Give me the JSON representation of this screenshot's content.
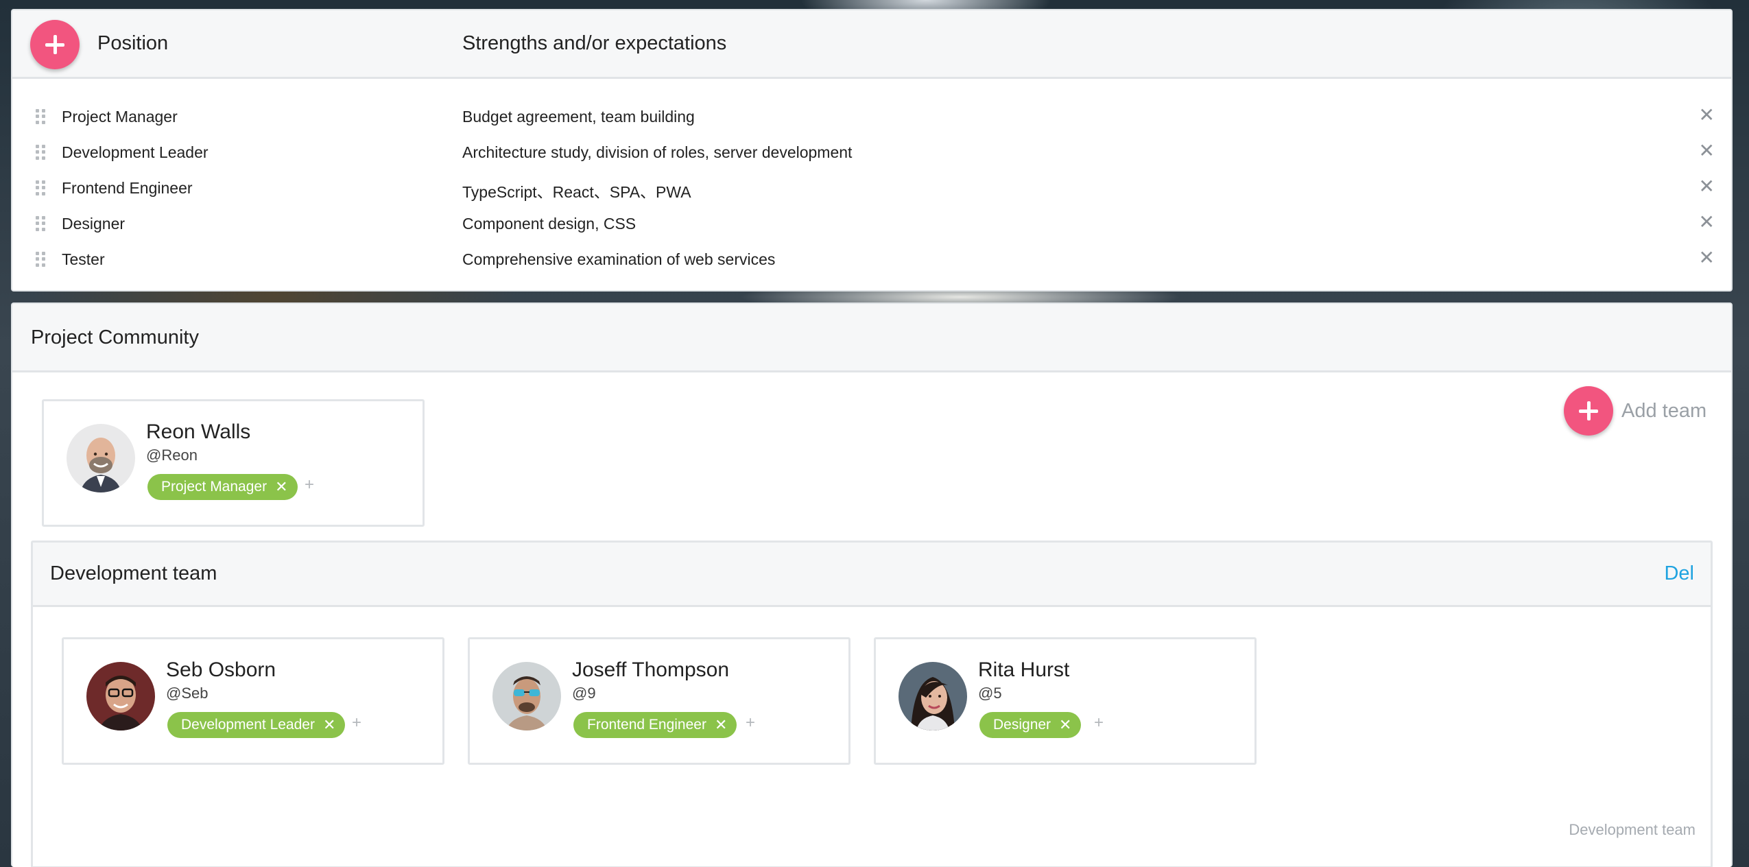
{
  "positions": {
    "header_position": "Position",
    "header_strengths": "Strengths and/or expectations",
    "rows": [
      {
        "name": "Project Manager",
        "strengths": "Budget agreement, team building"
      },
      {
        "name": "Development Leader",
        "strengths": "Architecture study, division of roles, server development"
      },
      {
        "name": "Frontend Engineer",
        "strengths": "TypeScript、React、SPA、PWA"
      },
      {
        "name": "Designer",
        "strengths": "Component design, CSS"
      },
      {
        "name": "Tester",
        "strengths": "Comprehensive examination of web services"
      }
    ],
    "close_glyph": "✕"
  },
  "community": {
    "title": "Project Community",
    "add_team_label": "Add team",
    "lead": {
      "name": "Reon Walls",
      "handle": "@Reon",
      "role": "Project Manager"
    },
    "team": {
      "title": "Development team",
      "del_label": "Del",
      "footer_label": "Development team",
      "members": [
        {
          "name": "Seb Osborn",
          "handle": "@Seb",
          "role": "Development Leader"
        },
        {
          "name": "Joseff Thompson",
          "handle": "@9",
          "role": "Frontend Engineer"
        },
        {
          "name": "Rita Hurst",
          "handle": "@5",
          "role": "Designer"
        }
      ]
    }
  },
  "colors": {
    "accent_pink": "#f2557f",
    "tag_green": "#8bc34a",
    "link_blue": "#1fa3e0"
  },
  "glyphs": {
    "tag_remove": "✕",
    "tag_add": "+"
  }
}
